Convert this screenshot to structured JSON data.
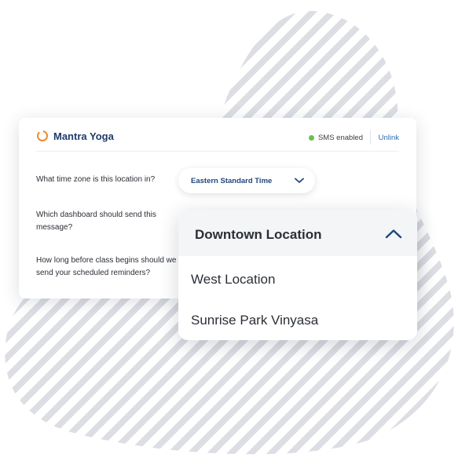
{
  "header": {
    "brand": "Mantra Yoga",
    "sms_status": "SMS enabled",
    "unlink_label": "Unlink"
  },
  "questions": {
    "timezone": "What time zone is this location in?",
    "dashboard": "Which dashboard should send this message?",
    "reminder": "How long before class begins should we send your scheduled reminders?"
  },
  "timezone_select": {
    "value": "Eastern Standard Time"
  },
  "location_dropdown": {
    "selected": "Downtown Location",
    "options": [
      "West Location",
      "Sunrise Park Vinyasa"
    ]
  },
  "colors": {
    "brand_text": "#1f3b6a",
    "logo_orange": "#ef8a2a",
    "status_green": "#6cc04a",
    "link_blue": "#2f6fb2",
    "stripe_gray": "#dcdee3"
  }
}
